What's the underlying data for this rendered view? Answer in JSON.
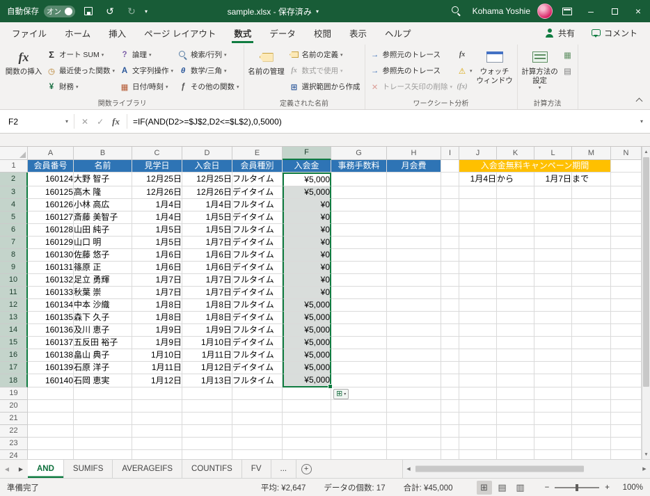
{
  "titlebar": {
    "autosave_label": "自動保存",
    "autosave_state": "オン",
    "doc_title": "sample.xlsx - 保存済み",
    "user_name": "Kohama Yoshie"
  },
  "ribbon": {
    "active_tab": "数式",
    "tabs": [
      "ファイル",
      "ホーム",
      "挿入",
      "ページ レイアウト",
      "数式",
      "データ",
      "校閲",
      "表示",
      "ヘルプ"
    ],
    "share_label": "共有",
    "comments_label": "コメント",
    "groups": {
      "function_library": {
        "label": "関数ライブラリ",
        "insert_function": "関数の挿入",
        "autosum": "オート SUM",
        "recent": "最近使った関数",
        "financial": "財務",
        "logical": "論理",
        "text": "文字列操作",
        "datetime": "日付/時刻",
        "lookup": "検索/行列",
        "math": "数学/三角",
        "more": "その他の関数"
      },
      "defined_names": {
        "label": "定義された名前",
        "name_manager": "名前の管理",
        "define_name": "名前の定義",
        "use_in_formula": "数式で使用",
        "create_from_selection": "選択範囲から作成"
      },
      "auditing": {
        "label": "ワークシート分析",
        "trace_precedents": "参照元のトレース",
        "trace_dependents": "参照先のトレース",
        "remove_arrows": "トレース矢印の削除",
        "watch_window": "ウォッチ ウィンドウ"
      },
      "calculation": {
        "label": "計算方法",
        "calc_options": "計算方法の設定"
      }
    }
  },
  "formula_bar": {
    "name_box": "F2",
    "formula": "=IF(AND(D2>=$J$2,D2<=$L$2),0,5000)"
  },
  "sheet": {
    "col_letters": [
      "A",
      "B",
      "C",
      "D",
      "E",
      "F",
      "G",
      "H",
      "I",
      "J",
      "K",
      "L",
      "M",
      "N"
    ],
    "row_count": 24,
    "headers": [
      "会員番号",
      "名前",
      "見学日",
      "入会日",
      "会員種別",
      "入会金",
      "事務手数料",
      "月会費"
    ],
    "campaign_header": "入会金無料キャンペーン期間",
    "campaign": {
      "start": "1月4日",
      "from_label": "から",
      "end": "1月7日",
      "to_label": "まで"
    },
    "members": [
      [
        "160124",
        "大野 智子",
        "12月25日",
        "12月25日",
        "フルタイム",
        "¥5,000"
      ],
      [
        "160125",
        "高木 隆",
        "12月26日",
        "12月26日",
        "デイタイム",
        "¥5,000"
      ],
      [
        "160126",
        "小林 高広",
        "1月4日",
        "1月4日",
        "フルタイム",
        "¥0"
      ],
      [
        "160127",
        "斎藤 美智子",
        "1月4日",
        "1月5日",
        "デイタイム",
        "¥0"
      ],
      [
        "160128",
        "山田 純子",
        "1月5日",
        "1月5日",
        "フルタイム",
        "¥0"
      ],
      [
        "160129",
        "山口 明",
        "1月5日",
        "1月7日",
        "デイタイム",
        "¥0"
      ],
      [
        "160130",
        "佐藤 悠子",
        "1月6日",
        "1月6日",
        "フルタイム",
        "¥0"
      ],
      [
        "160131",
        "篠原 正",
        "1月6日",
        "1月6日",
        "デイタイム",
        "¥0"
      ],
      [
        "160132",
        "足立 勇輝",
        "1月7日",
        "1月7日",
        "フルタイム",
        "¥0"
      ],
      [
        "160133",
        "秋葉 崇",
        "1月7日",
        "1月7日",
        "デイタイム",
        "¥0"
      ],
      [
        "160134",
        "中本 沙織",
        "1月8日",
        "1月8日",
        "フルタイム",
        "¥5,000"
      ],
      [
        "160135",
        "森下 久子",
        "1月8日",
        "1月8日",
        "デイタイム",
        "¥5,000"
      ],
      [
        "160136",
        "及川 恵子",
        "1月9日",
        "1月9日",
        "フルタイム",
        "¥5,000"
      ],
      [
        "160137",
        "五反田 裕子",
        "1月9日",
        "1月10日",
        "デイタイム",
        "¥5,000"
      ],
      [
        "160138",
        "畠山 典子",
        "1月10日",
        "1月11日",
        "フルタイム",
        "¥5,000"
      ],
      [
        "160139",
        "石原 洋子",
        "1月11日",
        "1月12日",
        "デイタイム",
        "¥5,000"
      ],
      [
        "160140",
        "石岡 恵実",
        "1月12日",
        "1月13日",
        "フルタイム",
        "¥5,000"
      ]
    ],
    "selection": {
      "active_cell": "F2",
      "range": "F2:F18"
    }
  },
  "sheet_tabs": {
    "active": "AND",
    "tabs": [
      "AND",
      "SUMIFS",
      "AVERAGEIFS",
      "COUNTIFS",
      "FV",
      "..."
    ]
  },
  "status_bar": {
    "mode": "準備完了",
    "average": "平均: ¥2,647",
    "count": "データの個数: 17",
    "sum": "合計: ¥45,000",
    "zoom_level": "100%"
  },
  "icons": {
    "undo": "↺",
    "redo": "↻",
    "dropdown": "▾",
    "sigma": "Σ",
    "recent": "◷",
    "financial": "¥",
    "logical": "?",
    "text_fn": "A",
    "date_fn": "▦",
    "math": "θ",
    "more_fn": "ƒ",
    "fx": "fx",
    "arrow_right": "→",
    "remove_x": "✕",
    "warning": "⚠",
    "fx_eval": "(fx)",
    "calc_now": "▦",
    "calc_sheet": "▤",
    "cancel": "✕",
    "enter": "✓",
    "plus": "+",
    "grid_plus": "⊞",
    "view_normal": "⊞",
    "view_layout": "▤",
    "view_break": "▥",
    "zoom_out": "−",
    "zoom_in": "+",
    "scroll_up": "▲",
    "scroll_down": "▼",
    "scroll_left": "◀",
    "scroll_right": "▶",
    "minimize": "–",
    "close": "×"
  }
}
